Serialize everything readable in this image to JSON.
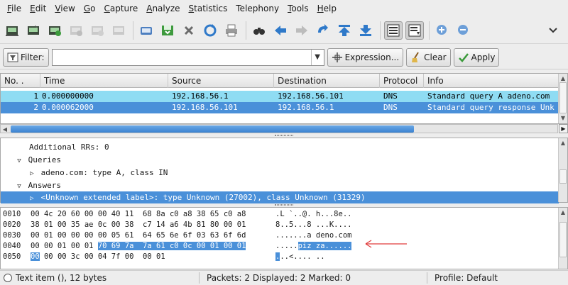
{
  "menubar": {
    "items": [
      {
        "label": "File",
        "mn": "F",
        "rest": "ile"
      },
      {
        "label": "Edit",
        "mn": "E",
        "rest": "dit"
      },
      {
        "label": "View",
        "mn": "V",
        "rest": "iew"
      },
      {
        "label": "Go",
        "mn": "G",
        "rest": "o"
      },
      {
        "label": "Capture",
        "mn": "C",
        "rest": "apture"
      },
      {
        "label": "Analyze",
        "mn": "A",
        "rest": "nalyze"
      },
      {
        "label": "Statistics",
        "mn": "S",
        "rest": "tatistics"
      },
      {
        "label": "Telephony",
        "mn": "",
        "rest": "Telephony"
      },
      {
        "label": "Tools",
        "mn": "T",
        "rest": "ools"
      },
      {
        "label": "Help",
        "mn": "H",
        "rest": "elp"
      }
    ]
  },
  "filterbar": {
    "filter_label": "Filter:",
    "filter_value": "",
    "expression_label": "Expression...",
    "clear_label": "Clear",
    "apply_label": "Apply"
  },
  "packet_list": {
    "columns": [
      "No. .",
      "Time",
      "Source",
      "Destination",
      "Protocol",
      "Info"
    ],
    "rows": [
      {
        "no": "1",
        "time": "0.000000000",
        "source": "192.168.56.1",
        "destination": "192.168.56.101",
        "protocol": "DNS",
        "info": "Standard query A adeno.com"
      },
      {
        "no": "2",
        "time": "0.000062000",
        "source": "192.168.56.101",
        "destination": "192.168.56.1",
        "protocol": "DNS",
        "info": "Standard query response Unk"
      }
    ]
  },
  "details": {
    "lines": [
      "Additional RRs: 0",
      "Queries",
      "adeno.com: type A, class IN",
      "Answers",
      "<Unknown extended label>: type Unknown (27002), class Unknown (31329)"
    ]
  },
  "bytes": {
    "rows": [
      {
        "off": "0010",
        "hex": "00 4c 20 60 00 00 40 11  68 8a c0 a8 38 65 c0 a8",
        "ascii": ".L `..@. h...8e.."
      },
      {
        "off": "0020",
        "hex": "38 01 00 35 ae 0c 00 38  c7 14 a6 4b 81 80 00 01",
        "ascii": "8..5...8 ...K...."
      },
      {
        "off": "0030",
        "hex": "00 01 00 00 00 00 05 61  64 65 6e 6f 03 63 6f 6d",
        "ascii": ".......a deno.com"
      },
      {
        "off": "0040",
        "hex_plain": "00 00 01 00 01 ",
        "hex_hl": "70 69 7a  7a 61 c0 0c 00 01 00 01",
        "ascii_plain": ".....",
        "ascii_hl": "piz za......"
      },
      {
        "off": "0050",
        "hex_hl": "00",
        "hex_plain": " 00 00 3c 00 04 7f 00  00 01",
        "ascii_hl": ".",
        "ascii_plain": "..<.... .."
      }
    ]
  },
  "statusbar": {
    "left": "Text item (), 12 bytes",
    "middle": "Packets: 2 Displayed: 2 Marked: 0",
    "right": "Profile: Default"
  },
  "colors": {
    "row_selected": "#4a90d9",
    "row_highlight": "#8fdcf3",
    "annotation_arrow": "#e03a3a"
  }
}
